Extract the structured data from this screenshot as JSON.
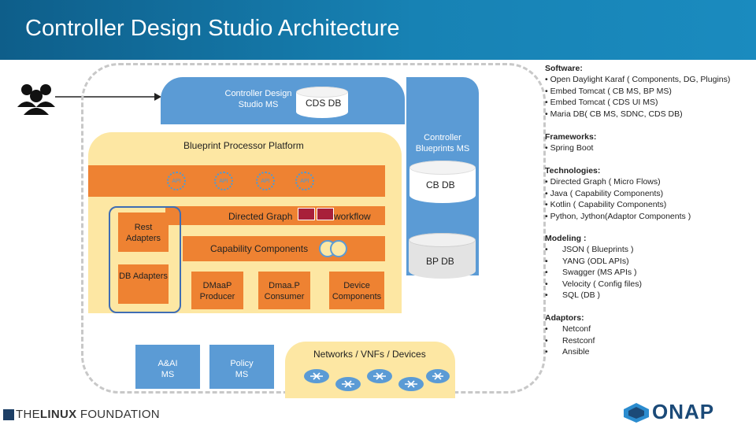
{
  "title": "Controller Design Studio Architecture",
  "diagram": {
    "controller_design_studio_ms": "Controller Design Studio MS",
    "cds_db": "CDS DB",
    "blueprint_processor_platform": "Blueprint Processor Platform",
    "controller_blueprints_ms": "Controller Blueprints MS",
    "cb_db": "CB DB",
    "api_labels": [
      "API",
      "API",
      "API",
      "API"
    ],
    "directed_graph_prefix": "Directed Graph",
    "directed_graph_suffix": "workflow",
    "rest_adapters": "Rest Adapters",
    "db_adapters": "DB Adapters",
    "capability_components": "Capability Components",
    "bp_db": "BP DB",
    "dmaap_producer": "DMaaP Producer",
    "dmaap_consumer": "Dmaa.P Consumer",
    "device_components": "Device Components",
    "aai_ms": "A&AI MS",
    "policy_ms": "Policy MS",
    "networks": "Networks / VNFs / Devices"
  },
  "side": {
    "software_title": "Software:",
    "software": [
      "Open Daylight Karaf ( Components, DG, Plugins)",
      "Embed Tomcat ( CB MS, BP MS)",
      "Embed Tomcat ( CDS UI MS)",
      "Maria DB( CB MS, SDNC, CDS DB)"
    ],
    "frameworks_title": "Frameworks:",
    "frameworks": [
      "Spring Boot"
    ],
    "technologies_title": "Technologies:",
    "technologies": [
      "Directed Graph ( Micro Flows)",
      "Java ( Capability Components)",
      "Kotlin ( Capability Components)",
      "Python, Jython(Adaptor Components )"
    ],
    "modeling_title": "Modeling :",
    "modeling": [
      "JSON ( Blueprints )",
      "YANG (ODL APIs)",
      "Swagger (MS APIs )",
      "Velocity ( Config files)",
      "SQL (DB )"
    ],
    "adaptors_title": "Adaptors:",
    "adaptors": [
      "Netconf",
      "Restconf",
      "Ansible"
    ]
  },
  "footer": {
    "lf_prefix": "THE",
    "lf_bold": "LINUX",
    "lf_suffix": " FOUNDATION",
    "onap": "ONAP"
  },
  "colors": {
    "header": "#1782b4",
    "blue_box": "#5b9bd5",
    "orange": "#ee8232",
    "yellow": "#fde7a3",
    "grey_cyl": "#e3e3e3"
  }
}
